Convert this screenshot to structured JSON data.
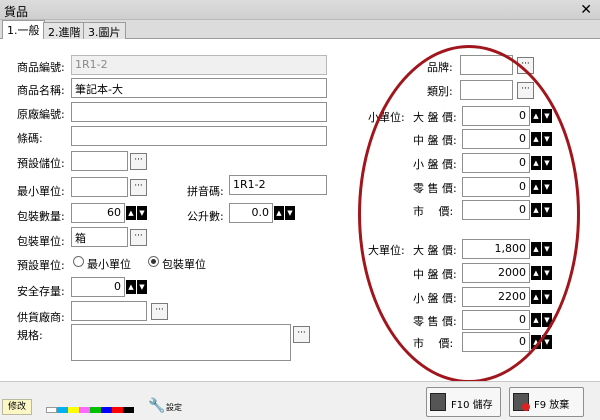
{
  "window": {
    "title": "貨品"
  },
  "tabs": [
    {
      "label": "1.一般"
    },
    {
      "label": "2.進階"
    },
    {
      "label": "3.圖片"
    }
  ],
  "form": {
    "product_code": {
      "label": "商品編號:",
      "value": "1R1-2"
    },
    "product_name": {
      "label": "商品名稱:",
      "value": "筆記本-大"
    },
    "vendor_code": {
      "label": "原廠編號:",
      "value": ""
    },
    "barcode": {
      "label": "條碼:",
      "value": ""
    },
    "default_location": {
      "label": "預設儲位:",
      "value": ""
    },
    "min_unit": {
      "label": "最小單位:",
      "value": ""
    },
    "pinyin": {
      "label": "拼音碼:",
      "value": "1R1-2"
    },
    "pack_qty": {
      "label": "包裝數量:",
      "value": "60"
    },
    "liters": {
      "label": "公升數:",
      "value": "0.0"
    },
    "pack_unit": {
      "label": "包裝單位:",
      "value": "箱"
    },
    "default_unit": {
      "label": "預設單位:",
      "option_min": "最小單位",
      "option_pack": "包裝單位",
      "selected": "包裝單位"
    },
    "safety_stock": {
      "label": "安全存量:",
      "value": "0"
    },
    "supplier": {
      "label": "供貨廠商:",
      "value": ""
    },
    "spec": {
      "label": "規格:",
      "value": ""
    },
    "brand": {
      "label": "品牌:",
      "value": ""
    },
    "category": {
      "label": "類別:",
      "value": ""
    }
  },
  "price_labels": {
    "small_unit": "小單位:",
    "large_unit": "大單位:",
    "big_wholesale": "大 盤 價:",
    "mid_wholesale": "中 盤 價:",
    "small_wholesale": "小 盤 價:",
    "retail": "零 售 價:",
    "market": "市　 價:"
  },
  "prices_small_unit": [
    "0",
    "0",
    "0",
    "0",
    "0"
  ],
  "prices_large_unit": [
    "1,800",
    "2000",
    "2200",
    "0",
    "0"
  ],
  "buttons": {
    "modify": "修改",
    "settings": "設定",
    "save": "F10 儲存",
    "discard": "F9 放棄"
  },
  "colors": {
    "highlight_ellipse": "#a0161c",
    "modify_bg": "#fcf7c4",
    "palette": [
      "#ffffff",
      "#00b0f0",
      "#ffff00",
      "#ff66ff",
      "#00c000",
      "#0000ff",
      "#ff0000",
      "#000000"
    ]
  }
}
